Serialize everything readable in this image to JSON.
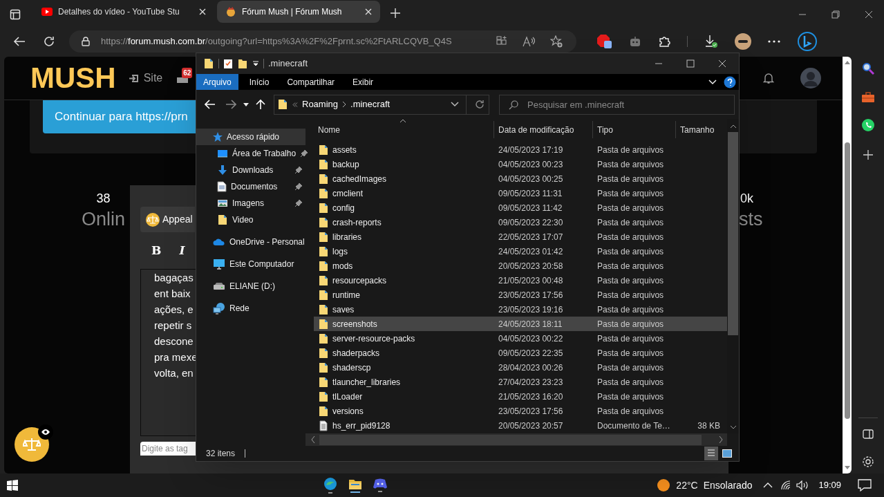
{
  "browser": {
    "tabs": [
      {
        "title": "Detalhes do vídeo - YouTube Stu",
        "kind": "video",
        "selected": false
      },
      {
        "title": "Fórum Mush | Fórum Mush",
        "kind": "forum",
        "selected": true
      }
    ],
    "address": {
      "scheme": "https://",
      "host": "forum.mush.com.br",
      "path": "/outgoing?url=https%3A%2F%2Fprnt.sc%2FtARLCQVB_Q4S"
    }
  },
  "page": {
    "logo": "MUSH",
    "nav_link": "Site",
    "badge": "62",
    "continue_button": "Continuar para https://prn",
    "stats": [
      {
        "value": "38",
        "label": "Onlin"
      },
      {
        "value": "0k",
        "label": "sts"
      }
    ],
    "editor": {
      "chip": "Appeal",
      "toolbar": [
        "B",
        "I"
      ],
      "lines": [
        "bagaças",
        "ent baix",
        "ações, e",
        "repetir s",
        "descone",
        "pra mexe",
        "volta, en"
      ],
      "tags_placeholder": "Digite as tag"
    }
  },
  "explorer": {
    "title": ".minecraft",
    "ribbon_tabs": [
      {
        "label": "Arquivo",
        "selected": true
      },
      {
        "label": "Início",
        "selected": false
      },
      {
        "label": "Compartilhar",
        "selected": false
      },
      {
        "label": "Exibir",
        "selected": false
      }
    ],
    "breadcrumb": [
      "Roaming",
      ".minecraft"
    ],
    "search": {
      "placeholder": "Pesquisar em .minecraft"
    },
    "nav": [
      {
        "label": "Acesso rápido",
        "kind": "quick",
        "selected": true,
        "children": [
          {
            "label": "Área de Trabalho",
            "kind": "desktop",
            "pinned": true,
            "selected": false
          },
          {
            "label": "Downloads",
            "kind": "download",
            "pinned": true,
            "selected": false
          },
          {
            "label": "Documentos",
            "kind": "documents",
            "pinned": true,
            "selected": false
          },
          {
            "label": "Imagens",
            "kind": "pictures",
            "pinned": true,
            "selected": false
          },
          {
            "label": "Video",
            "kind": "folder",
            "pinned": false,
            "selected": false
          }
        ]
      },
      {
        "label": "OneDrive - Personal",
        "kind": "cloud",
        "selected": false
      },
      {
        "label": "Este Computador",
        "kind": "computer",
        "selected": false
      },
      {
        "label": "ELIANE (D:)",
        "kind": "drive",
        "selected": false
      },
      {
        "label": "Rede",
        "kind": "network",
        "selected": false
      }
    ],
    "columns": [
      "Nome",
      "Data de modificação",
      "Tipo",
      "Tamanho"
    ],
    "files": [
      {
        "name": "assets",
        "kind": "folder",
        "modified": "24/05/2023 17:19",
        "type": "Pasta de arquivos",
        "selected": false
      },
      {
        "name": "backup",
        "kind": "folder",
        "modified": "04/05/2023 00:23",
        "type": "Pasta de arquivos",
        "selected": false
      },
      {
        "name": "cachedImages",
        "kind": "folder",
        "modified": "04/05/2023 00:25",
        "type": "Pasta de arquivos",
        "selected": false
      },
      {
        "name": "cmclient",
        "kind": "folder",
        "modified": "09/05/2023 11:31",
        "type": "Pasta de arquivos",
        "selected": false
      },
      {
        "name": "config",
        "kind": "folder",
        "modified": "09/05/2023 11:42",
        "type": "Pasta de arquivos",
        "selected": false
      },
      {
        "name": "crash-reports",
        "kind": "folder",
        "modified": "09/05/2023 22:30",
        "type": "Pasta de arquivos",
        "selected": false
      },
      {
        "name": "libraries",
        "kind": "folder",
        "modified": "22/05/2023 17:07",
        "type": "Pasta de arquivos",
        "selected": false
      },
      {
        "name": "logs",
        "kind": "folder",
        "modified": "24/05/2023 01:42",
        "type": "Pasta de arquivos",
        "selected": false
      },
      {
        "name": "mods",
        "kind": "folder",
        "modified": "20/05/2023 20:58",
        "type": "Pasta de arquivos",
        "selected": false
      },
      {
        "name": "resourcepacks",
        "kind": "folder",
        "modified": "21/05/2023 00:48",
        "type": "Pasta de arquivos",
        "selected": false
      },
      {
        "name": "runtime",
        "kind": "folder",
        "modified": "23/05/2023 17:56",
        "type": "Pasta de arquivos",
        "selected": false
      },
      {
        "name": "saves",
        "kind": "folder",
        "modified": "23/05/2023 19:16",
        "type": "Pasta de arquivos",
        "selected": false
      },
      {
        "name": "screenshots",
        "kind": "folder",
        "modified": "24/05/2023 18:11",
        "type": "Pasta de arquivos",
        "selected": true
      },
      {
        "name": "server-resource-packs",
        "kind": "folder",
        "modified": "04/05/2023 00:22",
        "type": "Pasta de arquivos",
        "selected": false
      },
      {
        "name": "shaderpacks",
        "kind": "folder",
        "modified": "09/05/2023 22:35",
        "type": "Pasta de arquivos",
        "selected": false
      },
      {
        "name": "shaderscp",
        "kind": "folder",
        "modified": "28/04/2023 00:26",
        "type": "Pasta de arquivos",
        "selected": false
      },
      {
        "name": "tlauncher_libraries",
        "kind": "folder",
        "modified": "27/04/2023 23:23",
        "type": "Pasta de arquivos",
        "selected": false
      },
      {
        "name": "tlLoader",
        "kind": "folder",
        "modified": "21/05/2023 16:20",
        "type": "Pasta de arquivos",
        "selected": false
      },
      {
        "name": "versions",
        "kind": "folder",
        "modified": "23/05/2023 17:56",
        "type": "Pasta de arquivos",
        "selected": false
      },
      {
        "name": "hs_err_pid9128",
        "kind": "document",
        "modified": "20/05/2023 20:57",
        "type": "Documento de Te…",
        "size": "38 KB",
        "selected": false
      }
    ],
    "status": "32 itens"
  },
  "taskbar": {
    "temperature": "22°C",
    "condition": "Ensolarado",
    "time": "19:09"
  }
}
